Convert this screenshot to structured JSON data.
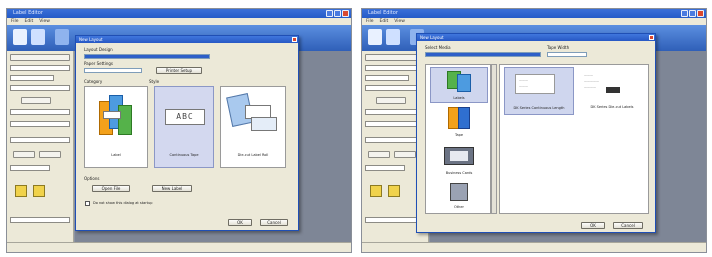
{
  "left_window": {
    "app_title": "Label Editor",
    "menu": [
      "File",
      "Edit",
      "View"
    ],
    "dialog": {
      "title": "New Layout",
      "section_layout": "Layout Design",
      "section_paper": "Paper Settings",
      "printer_button": "Printer Setup",
      "category_label": "Category",
      "preview_label": "Style",
      "items": [
        {
          "caption": "Label"
        },
        {
          "caption": "Continuous Tape",
          "sample": "ABC"
        },
        {
          "caption": "Die-cut Label Roll"
        }
      ],
      "options_label": "Options",
      "open_button": "Open File",
      "new_button": "New Label",
      "checkbox_label": "Do not show this dialog at startup",
      "ok_button": "OK",
      "cancel_button": "Cancel"
    }
  },
  "right_window": {
    "app_title": "Label Editor",
    "menu": [
      "File",
      "Edit",
      "View"
    ],
    "dialog": {
      "title": "New Layout",
      "section_left": "Select Media",
      "section_right": "Tape Width",
      "categories": [
        {
          "caption": "Labels"
        },
        {
          "caption": "Tape"
        },
        {
          "caption": "Business Cards"
        },
        {
          "caption": "Other"
        }
      ],
      "preview_cards": [
        {
          "caption": "DK Series Continuous Length"
        },
        {
          "caption": "DK Series Die-cut Labels"
        }
      ],
      "ok_button": "OK",
      "cancel_button": "Cancel"
    }
  }
}
